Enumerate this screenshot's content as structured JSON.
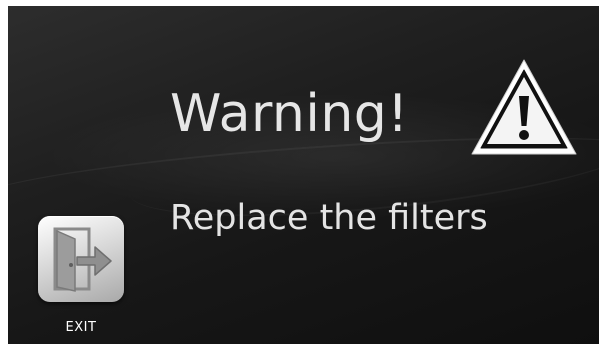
{
  "dialog": {
    "title": "Warning!",
    "message": "Replace the filters"
  },
  "icons": {
    "warning": "warning-triangle-icon",
    "exit": "exit-door-icon"
  },
  "exit_button": {
    "label": "EXIT"
  },
  "colors": {
    "background": "#1c1c1c",
    "text": "#e6e6e6",
    "tile_light": "#ffffff",
    "tile_dark": "#a9a9a9"
  }
}
